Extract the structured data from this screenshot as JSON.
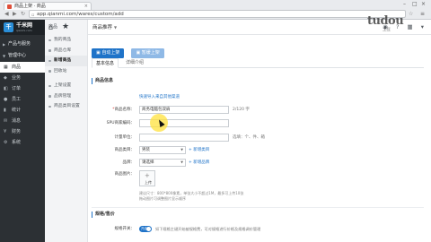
{
  "browser": {
    "tab_title": "商品上架 · 商品",
    "tab_close": "×",
    "url": "app.qianmi.com/wares/custom/add",
    "window_controls": [
      "–",
      "□",
      "×"
    ]
  },
  "sidebar": {
    "logo_name": "千米网",
    "logo_url": "qianmi.com",
    "groups": [
      {
        "label": "产品与服务"
      },
      {
        "label": "管理中心"
      }
    ],
    "items": [
      {
        "label": "商品",
        "icon": "grid-icon",
        "glyph": "▦"
      },
      {
        "label": "业务",
        "icon": "tag-icon",
        "glyph": "◆"
      },
      {
        "label": "订单",
        "icon": "cart-icon",
        "glyph": "◧"
      },
      {
        "label": "员工",
        "icon": "user-icon",
        "glyph": "●"
      },
      {
        "label": "统计",
        "icon": "stats-icon",
        "glyph": "▮"
      },
      {
        "label": "消息",
        "icon": "message-icon",
        "glyph": "✉"
      },
      {
        "label": "财务",
        "icon": "money-icon",
        "glyph": "¥"
      },
      {
        "label": "系统",
        "icon": "gear-icon",
        "glyph": "⚙"
      }
    ]
  },
  "subnav": {
    "title": "商品",
    "items": [
      "我的商品",
      "商品仓库",
      "新增商品",
      "回收站"
    ],
    "items2": [
      "上架设置",
      "品牌管理",
      "商品类目设置"
    ]
  },
  "topbar": {
    "breadcrumb": "商品推荐",
    "icons": [
      "bell-icon",
      "help-icon",
      "grid-menu-icon",
      "user-menu-icon"
    ],
    "glyphs": [
      "◉",
      "?",
      "▦",
      "▾"
    ]
  },
  "actions": {
    "primary": "自动上架",
    "secondary": "暂缓上架"
  },
  "tabs": [
    "基本信息",
    "详细介绍"
  ],
  "form": {
    "section_title": "商品信息",
    "quick_import": "快速导入来自其他渠道",
    "name_label": "商品名称：",
    "name_value": "商务电脑包双肩",
    "name_note": "2/120 字",
    "sku_label": "SPU商家编码：",
    "unit_label": "计量单位：",
    "unit_note": "选填：个、件、箱",
    "category_label": "商品类目：",
    "category_value": "男装",
    "category_add": "+ 新增类目",
    "brand_label": "品牌：",
    "brand_value": "请选择",
    "brand_add": "+ 新增品牌",
    "image_label": "商品图片：",
    "upload_label": "上传",
    "help_line1": "建议尺寸：800*800像素，单张大小不超过1M，最多可上传10张",
    "help_line2": "拖动图片可调整图片显示顺序"
  },
  "spec": {
    "section_title": "规格/售价",
    "toggle_label": "规格开关：",
    "toggle_state": "开启",
    "toggle_note": "如下规格主键开始被规格费，可对规格进行价格及规格调价管理"
  },
  "watermark": {
    "brand": "tudou",
    "sub": "土豆"
  }
}
